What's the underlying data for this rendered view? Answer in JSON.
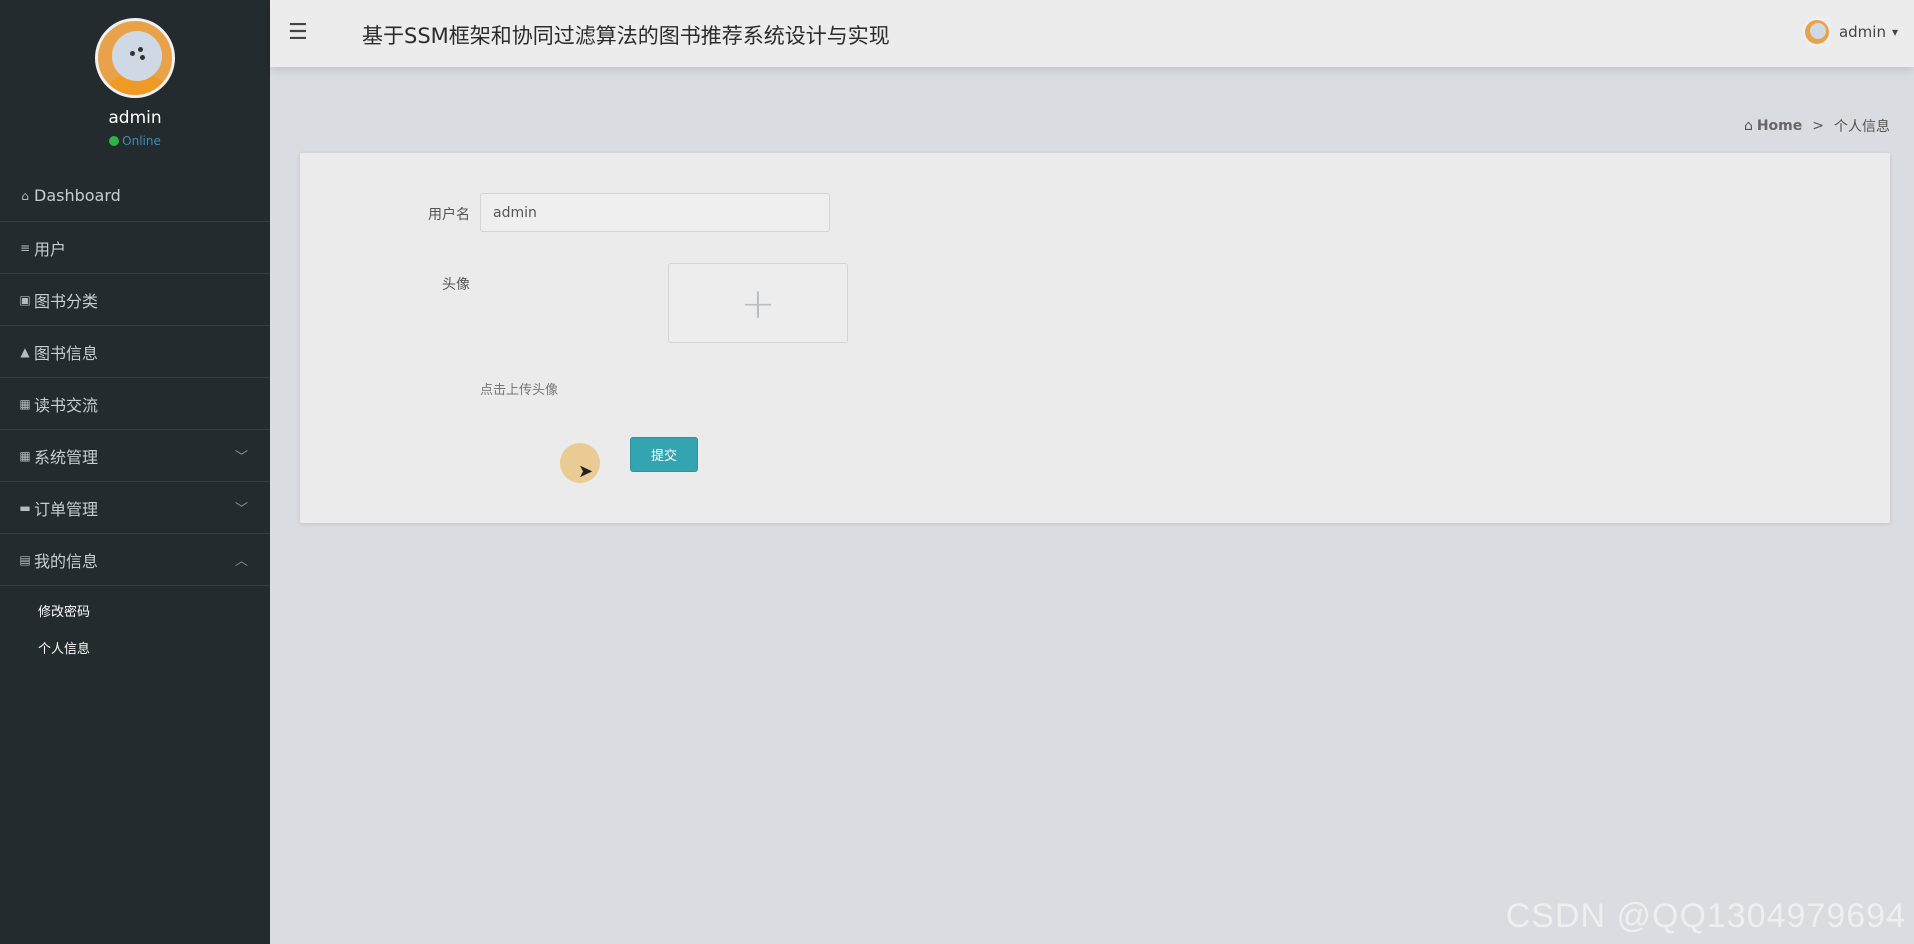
{
  "sidebar": {
    "profile": {
      "name": "admin",
      "status": "Online"
    },
    "items": [
      {
        "label": "Dashboard",
        "icon": "home-icon"
      },
      {
        "label": "用户",
        "icon": "list-icon"
      },
      {
        "label": "图书分类",
        "icon": "calendar-icon"
      },
      {
        "label": "图书信息",
        "icon": "person-icon"
      },
      {
        "label": "读书交流",
        "icon": "grid-icon"
      },
      {
        "label": "系统管理",
        "icon": "grid-icon"
      },
      {
        "label": "订单管理",
        "icon": "comment-icon"
      },
      {
        "label": "我的信息",
        "icon": "card-icon"
      }
    ],
    "sub_items": [
      {
        "label": "修改密码"
      },
      {
        "label": "个人信息"
      }
    ]
  },
  "header": {
    "title": "基于SSM框架和协同过滤算法的图书推荐系统设计与实现",
    "user": "admin"
  },
  "breadcrumb": {
    "home": "Home",
    "separator": ">",
    "current": "个人信息"
  },
  "form": {
    "username_label": "用户名",
    "username_value": "admin",
    "avatar_label": "头像",
    "upload_plus": "+",
    "upload_hint": "点击上传头像",
    "submit_label": "提交"
  },
  "watermark": "CSDN @QQ1304979694"
}
